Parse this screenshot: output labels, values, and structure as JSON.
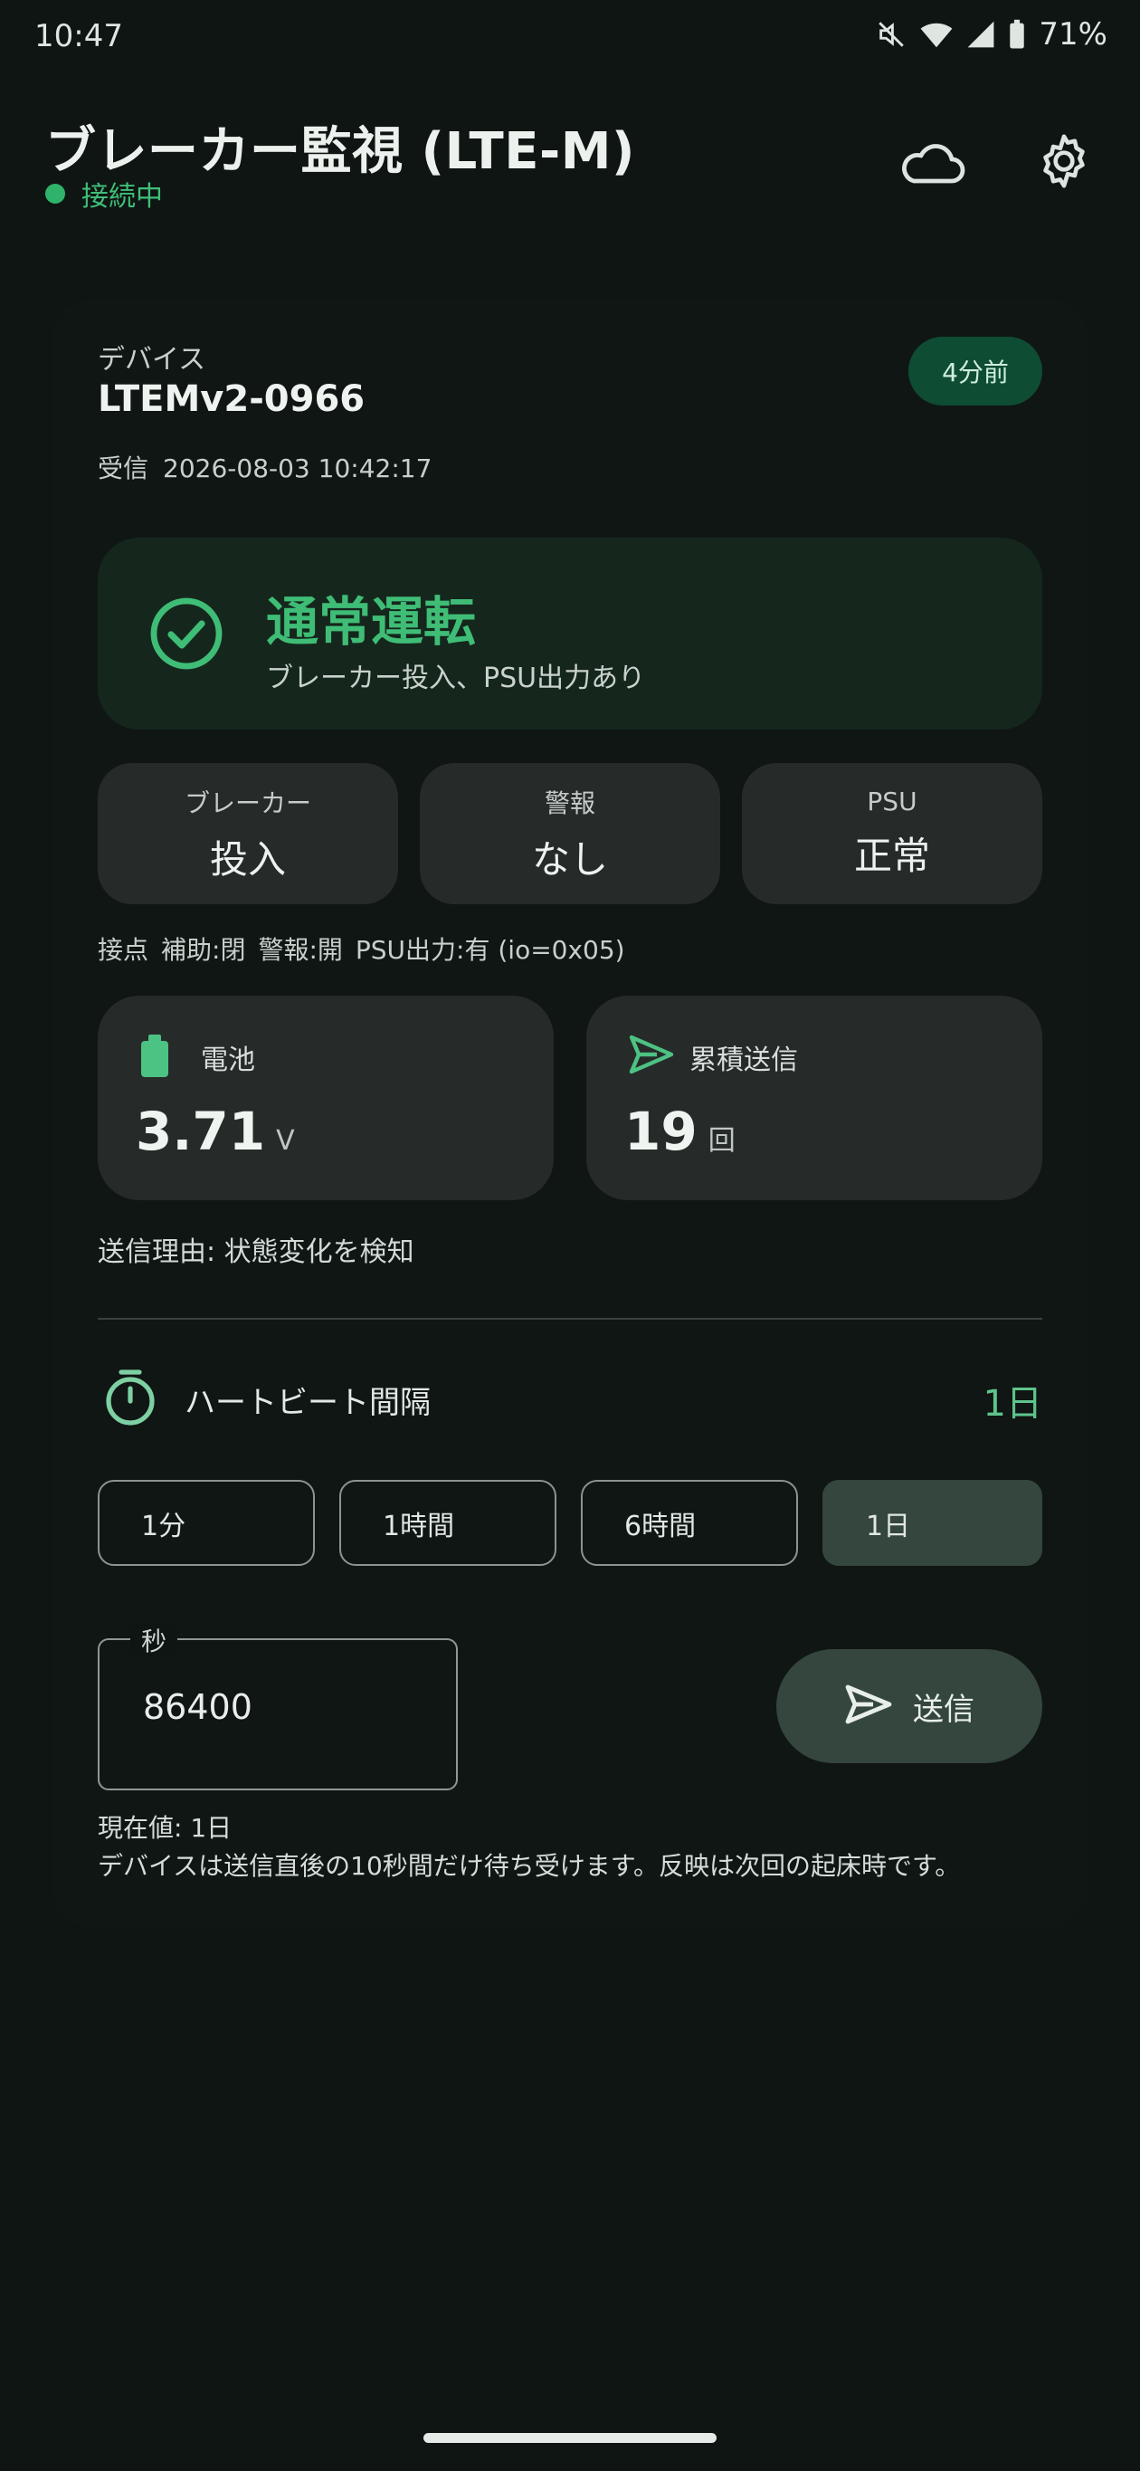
{
  "status_bar": {
    "time": "10:47",
    "battery_percent": "71%"
  },
  "app_bar": {
    "title": "ブレーカー監視 (LTE-M)",
    "connection_status": "接続中",
    "icons": [
      "cloud-icon",
      "gear-icon"
    ]
  },
  "device": {
    "label": "デバイス",
    "name": "LTEMv2-0966",
    "received_label": "受信",
    "received_at": "2026-08-03 10:42:17",
    "age_badge": "4分前"
  },
  "state": {
    "title": "通常運転",
    "subtitle": "ブレーカー投入、PSU出力あり"
  },
  "tiles": [
    {
      "label": "ブレーカー",
      "value": "投入"
    },
    {
      "label": "警報",
      "value": "なし"
    },
    {
      "label": "PSU",
      "value": "正常"
    }
  ],
  "contacts": {
    "label": "接点",
    "aux": "補助:閉",
    "alarm": "警報:開",
    "psu": "PSU出力:有 (io=0x05)"
  },
  "metrics": {
    "battery": {
      "label": "電池",
      "value": "3.71",
      "unit": "V"
    },
    "sent_total": {
      "label": "累積送信",
      "value": "19",
      "unit": "回"
    }
  },
  "send_reason": "送信理由: 状態変化を検知",
  "heartbeat": {
    "title": "ハートビート間隔",
    "current": "1日",
    "options": [
      "1分",
      "1時間",
      "6時間",
      "1日"
    ],
    "selected_index": 3,
    "seconds_label": "秒",
    "seconds_value": "86400",
    "send_button": "送信",
    "current_value_text": "現在値: 1日",
    "note": "デバイスは送信直後の10秒間だけ待ち受けます。反映は次回の起床時です。"
  },
  "colors": {
    "background": "#0f1513",
    "accent_green": "#3fbd76",
    "tile_bg": "#262b29",
    "state_card_bg": "#15271d",
    "selected_segment_bg": "#34463d"
  }
}
